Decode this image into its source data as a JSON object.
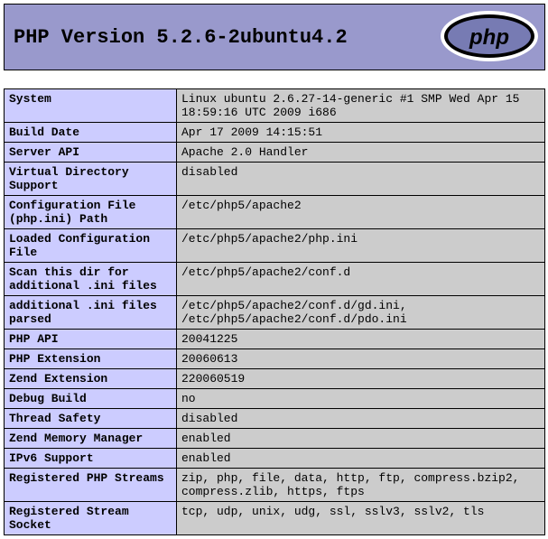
{
  "header": {
    "title": "PHP Version 5.2.6-2ubuntu4.2"
  },
  "rows": [
    {
      "key": "System",
      "val": "Linux ubuntu 2.6.27-14-generic #1 SMP Wed Apr 15 18:59:16 UTC 2009 i686"
    },
    {
      "key": "Build Date",
      "val": "Apr 17 2009 14:15:51"
    },
    {
      "key": "Server API",
      "val": "Apache 2.0 Handler"
    },
    {
      "key": "Virtual Directory Support",
      "val": "disabled"
    },
    {
      "key": "Configuration File (php.ini) Path",
      "val": "/etc/php5/apache2"
    },
    {
      "key": "Loaded Configuration File",
      "val": "/etc/php5/apache2/php.ini"
    },
    {
      "key": "Scan this dir for additional .ini files",
      "val": "/etc/php5/apache2/conf.d"
    },
    {
      "key": "additional .ini files parsed",
      "val": "/etc/php5/apache2/conf.d/gd.ini, /etc/php5/apache2/conf.d/pdo.ini"
    },
    {
      "key": "PHP API",
      "val": "20041225"
    },
    {
      "key": "PHP Extension",
      "val": "20060613"
    },
    {
      "key": "Zend Extension",
      "val": "220060519"
    },
    {
      "key": "Debug Build",
      "val": "no"
    },
    {
      "key": "Thread Safety",
      "val": "disabled"
    },
    {
      "key": "Zend Memory Manager",
      "val": "enabled"
    },
    {
      "key": "IPv6 Support",
      "val": "enabled"
    },
    {
      "key": "Registered PHP Streams",
      "val": "zip, php, file, data, http, ftp, compress.bzip2, compress.zlib, https, ftps"
    },
    {
      "key": "Registered Stream Socket",
      "val": "tcp, udp, unix, udg, ssl, sslv3, sslv2, tls"
    }
  ]
}
